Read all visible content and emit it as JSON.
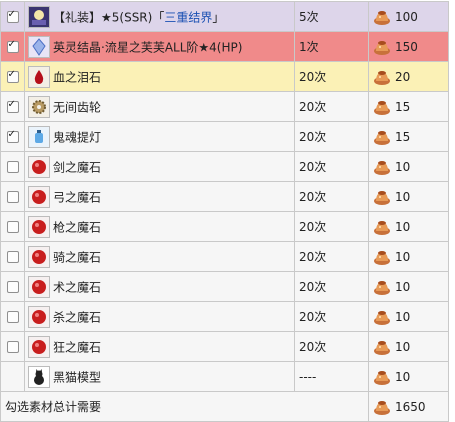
{
  "rows": [
    {
      "checked": true,
      "icon": "ce-card-icon",
      "name_prefix": "【礼装】★5(SSR)「",
      "name_link": "三重结界",
      "name_suffix": "」",
      "qty": "5次",
      "cost": "100",
      "row_color": "#ddd5ea"
    },
    {
      "checked": true,
      "icon": "spirit-crystal-icon",
      "name": "英灵结晶·流星之芙芙ALL阶★4(HP)",
      "qty": "1次",
      "cost": "150",
      "row_color": "#f08a8a"
    },
    {
      "checked": true,
      "icon": "blood-tear-icon",
      "name": "血之泪石",
      "qty": "20次",
      "cost": "20",
      "row_color": "#fbf1b6"
    },
    {
      "checked": true,
      "icon": "gear-icon",
      "name": "无间齿轮",
      "qty": "20次",
      "cost": "15"
    },
    {
      "checked": true,
      "icon": "ghost-lantern-icon",
      "name": "鬼魂提灯",
      "qty": "20次",
      "cost": "15"
    },
    {
      "checked": false,
      "icon": "saber-magic-stone-icon",
      "name": "剑之魔石",
      "qty": "20次",
      "cost": "10"
    },
    {
      "checked": false,
      "icon": "archer-magic-stone-icon",
      "name": "弓之魔石",
      "qty": "20次",
      "cost": "10"
    },
    {
      "checked": false,
      "icon": "lancer-magic-stone-icon",
      "name": "枪之魔石",
      "qty": "20次",
      "cost": "10"
    },
    {
      "checked": false,
      "icon": "rider-magic-stone-icon",
      "name": "骑之魔石",
      "qty": "20次",
      "cost": "10"
    },
    {
      "checked": false,
      "icon": "caster-magic-stone-icon",
      "name": "术之魔石",
      "qty": "20次",
      "cost": "10"
    },
    {
      "checked": false,
      "icon": "assassin-magic-stone-icon",
      "name": "杀之魔石",
      "qty": "20次",
      "cost": "10"
    },
    {
      "checked": false,
      "icon": "berserker-magic-stone-icon",
      "name": "狂之魔石",
      "qty": "20次",
      "cost": "10"
    },
    {
      "checked": null,
      "icon": "black-cat-icon",
      "name": "黑猫模型",
      "qty": "----",
      "cost": "10"
    }
  ],
  "total": {
    "label": "勾选素材总计需要",
    "cost": "1650"
  },
  "currency_icon": "pudding-currency-icon",
  "colors": {
    "accent_link": "#1a50b3",
    "magic_stone_red": "#c81e1e"
  }
}
